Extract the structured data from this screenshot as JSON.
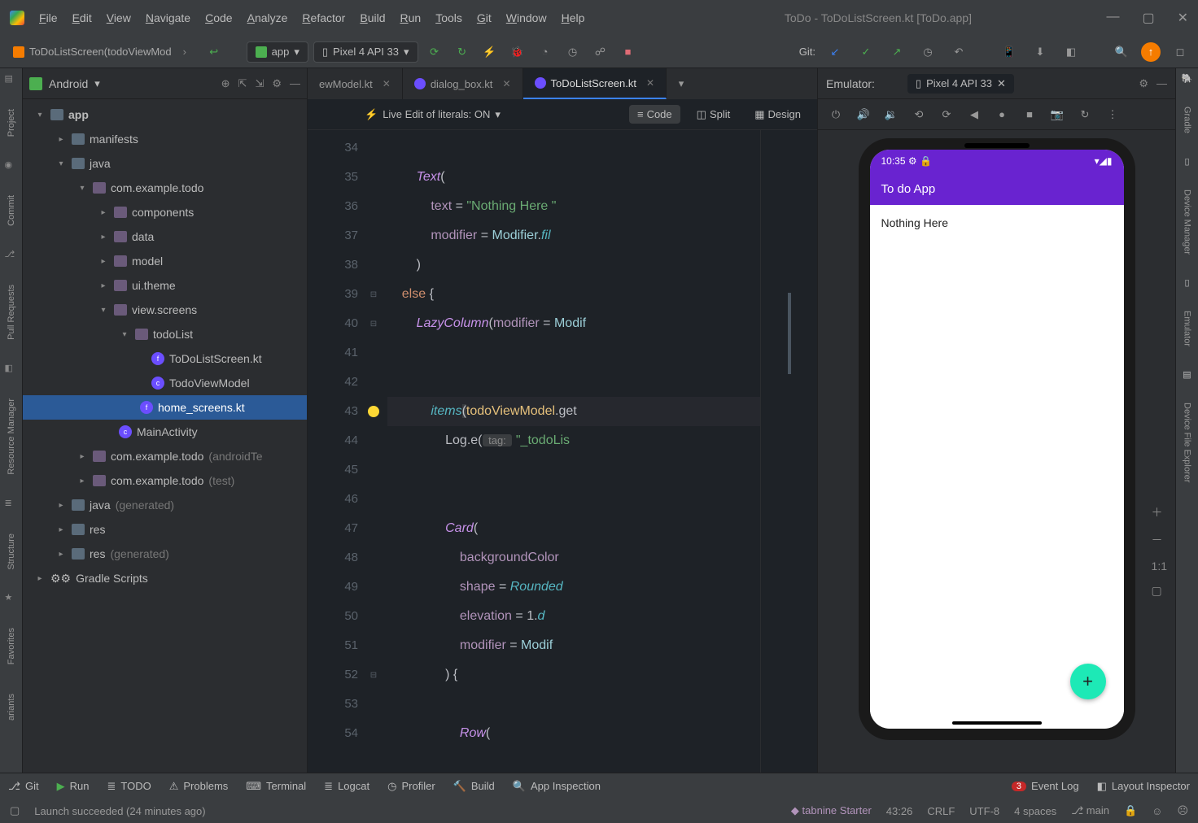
{
  "window": {
    "title": "ToDo - ToDoListScreen.kt [ToDo.app]"
  },
  "menu": [
    "File",
    "Edit",
    "View",
    "Navigate",
    "Code",
    "Analyze",
    "Refactor",
    "Build",
    "Run",
    "Tools",
    "Git",
    "Window",
    "Help"
  ],
  "toolbar": {
    "breadcrumb": "ToDoListScreen(todoViewMod",
    "run_config": "app",
    "device": "Pixel 4 API 33",
    "git_label": "Git:"
  },
  "project": {
    "selector": "Android",
    "tree": {
      "app": "app",
      "manifests": "manifests",
      "java": "java",
      "pkg": "com.example.todo",
      "components": "components",
      "data": "data",
      "model": "model",
      "ui_theme": "ui.theme",
      "view_screens": "view.screens",
      "todoList": "todoList",
      "ToDoListScreen": "ToDoListScreen.kt",
      "TodoViewModel": "TodoViewModel",
      "home_screens": "home_screens.kt",
      "MainActivity": "MainActivity",
      "pkg_android_test": "com.example.todo",
      "pkg_android_test_suffix": "(androidTe",
      "pkg_test": "com.example.todo",
      "pkg_test_suffix": "(test)",
      "java_gen": "java",
      "java_gen_suffix": "(generated)",
      "res": "res",
      "res_gen": "res",
      "res_gen_suffix": "(generated)",
      "gradle": "Gradle Scripts"
    }
  },
  "editor": {
    "tabs": {
      "t0": "ewModel.kt",
      "t1": "dialog_box.kt",
      "t2": "ToDoListScreen.kt"
    },
    "live_edit": "Live Edit of literals: ON",
    "modes": {
      "code": "Code",
      "split": "Split",
      "design": "Design"
    },
    "warnings": "1",
    "hints": "1",
    "lines": {
      "34": "34",
      "35": "35",
      "36": "36",
      "37": "37",
      "38": "38",
      "39": "39",
      "40": "40",
      "41": "41",
      "42": "42",
      "43": "43",
      "44": "44",
      "45": "45",
      "46": "46",
      "47": "47",
      "48": "48",
      "49": "49",
      "50": "50",
      "51": "51",
      "52": "52",
      "53": "53",
      "54": "54"
    },
    "code": {
      "l35_fn": "Text",
      "l35_rest": "(",
      "l36_prop": "text",
      "l36_eq": " = ",
      "l36_str": "\"Nothing Here \"",
      "l37_prop": "modifier",
      "l37_eq": " = ",
      "l37_ty": "Modifier",
      "l37_dot": ".",
      "l37_fn": "fil",
      "l38": ")",
      "l39_kw": "else",
      "l39_rest": " {",
      "l40_fn": "LazyColumn",
      "l40_lp": "(",
      "l40_prop": "modifier",
      "l40_eq": " = ",
      "l40_ty": "Modif",
      "l43_fn": "items",
      "l43_lp": "(",
      "l43_arg": "todoViewModel",
      "l43_dot": ".get",
      "l44_log": "Log",
      "l44_dot": ".e(",
      "l44_hint": " tag: ",
      "l44_str": "\"_todoLis",
      "l47_fn": "Card",
      "l47_rest": "(",
      "l48_prop": "backgroundColor",
      "l49_prop": "shape",
      "l49_eq": " = ",
      "l49_ty": "Rounded",
      "l50_prop": "elevation",
      "l50_eq": " = 1.",
      "l50_unit": "d",
      "l51_prop": "modifier",
      "l51_eq": " = ",
      "l51_ty": "Modif",
      "l52": ") {",
      "l54_fn": "Row",
      "l54_rest": "("
    }
  },
  "emulator": {
    "label": "Emulator:",
    "device": "Pixel 4 API 33",
    "phone": {
      "time": "10:35",
      "appbar": "To do App",
      "body": "Nothing Here",
      "fab": "+"
    }
  },
  "bottom": {
    "git": "Git",
    "run": "Run",
    "todo": "TODO",
    "problems": "Problems",
    "terminal": "Terminal",
    "logcat": "Logcat",
    "profiler": "Profiler",
    "build": "Build",
    "inspection": "App Inspection",
    "event_count": "3",
    "event_log": "Event Log",
    "layout": "Layout Inspector"
  },
  "status": {
    "msg": "Launch succeeded (24 minutes ago)",
    "tabnine": "tabnine Starter",
    "pos": "43:26",
    "enc": "CRLF",
    "charset": "UTF-8",
    "indent": "4 spaces",
    "branch": "main"
  },
  "left_stripe": [
    "Project",
    "Commit",
    "Pull Requests",
    "Resource Manager",
    "Structure",
    "Favorites",
    "ariants"
  ],
  "right_stripe": [
    "Gradle",
    "Device Manager",
    "Emulator",
    "Device File Explorer"
  ]
}
